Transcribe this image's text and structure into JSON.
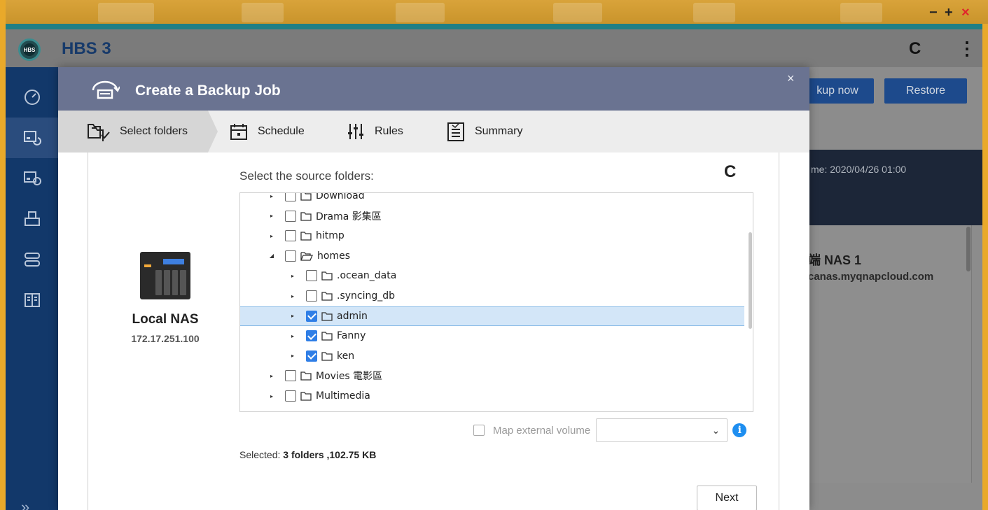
{
  "desktop": {
    "window_controls": [
      "−",
      "+",
      "×"
    ]
  },
  "app": {
    "title": "HBS 3",
    "logo_text": "HBS",
    "header_refresh": "C",
    "header_more": "⋮",
    "sidebar": {
      "expand": "»",
      "items": [
        {
          "icon": "dashboard-icon"
        },
        {
          "icon": "backup-restore-icon",
          "active": true
        },
        {
          "icon": "sync-icon"
        },
        {
          "icon": "storage-icon"
        },
        {
          "icon": "services-icon"
        },
        {
          "icon": "logs-icon"
        }
      ]
    },
    "background": {
      "backup_now_label": "kup now",
      "restore_label": "Restore",
      "last_time_text": "me: 2020/04/26 01:00",
      "nas_title": "端 NAS 1",
      "nas_domain": "canas.myqnapcloud.com"
    }
  },
  "modal": {
    "title": "Create a Backup Job",
    "close": "×",
    "steps": [
      {
        "label": "Select folders",
        "icon": "select-folders-icon"
      },
      {
        "label": "Schedule",
        "icon": "calendar-icon"
      },
      {
        "label": "Rules",
        "icon": "sliders-icon"
      },
      {
        "label": "Summary",
        "icon": "clipboard-icon"
      }
    ],
    "source": {
      "name": "Local NAS",
      "ip": "172.17.251.100"
    },
    "folders_label": "Select the source folders:",
    "refresh": "C",
    "tree": [
      {
        "name": "Download",
        "level": 1,
        "caret": "▸",
        "checked": false,
        "open": false
      },
      {
        "name": "Drama 影集區",
        "level": 1,
        "caret": "▸",
        "checked": false,
        "open": false
      },
      {
        "name": "hitmp",
        "level": 1,
        "caret": "▸",
        "checked": false,
        "open": false
      },
      {
        "name": "homes",
        "level": 1,
        "caret": "◢",
        "checked": false,
        "open": true
      },
      {
        "name": ".ocean_data",
        "level": 2,
        "caret": "▸",
        "checked": false,
        "open": false
      },
      {
        "name": ".syncing_db",
        "level": 2,
        "caret": "▸",
        "checked": false,
        "open": false
      },
      {
        "name": "admin",
        "level": 2,
        "caret": "▸",
        "checked": true,
        "open": false,
        "selected": true
      },
      {
        "name": "Fanny",
        "level": 2,
        "caret": "▸",
        "checked": true,
        "open": false
      },
      {
        "name": "ken",
        "level": 2,
        "caret": "▸",
        "checked": true,
        "open": false
      },
      {
        "name": "Movies 電影區",
        "level": 1,
        "caret": "▸",
        "checked": false,
        "open": false
      },
      {
        "name": "Multimedia",
        "level": 1,
        "caret": "▸",
        "checked": false,
        "open": false
      }
    ],
    "map_external_label": "Map external volume",
    "map_external_value": "",
    "info": "i",
    "selected_prefix": "Selected:",
    "selected_value": "3 folders ,102.75 KB",
    "next_label": "Next"
  }
}
